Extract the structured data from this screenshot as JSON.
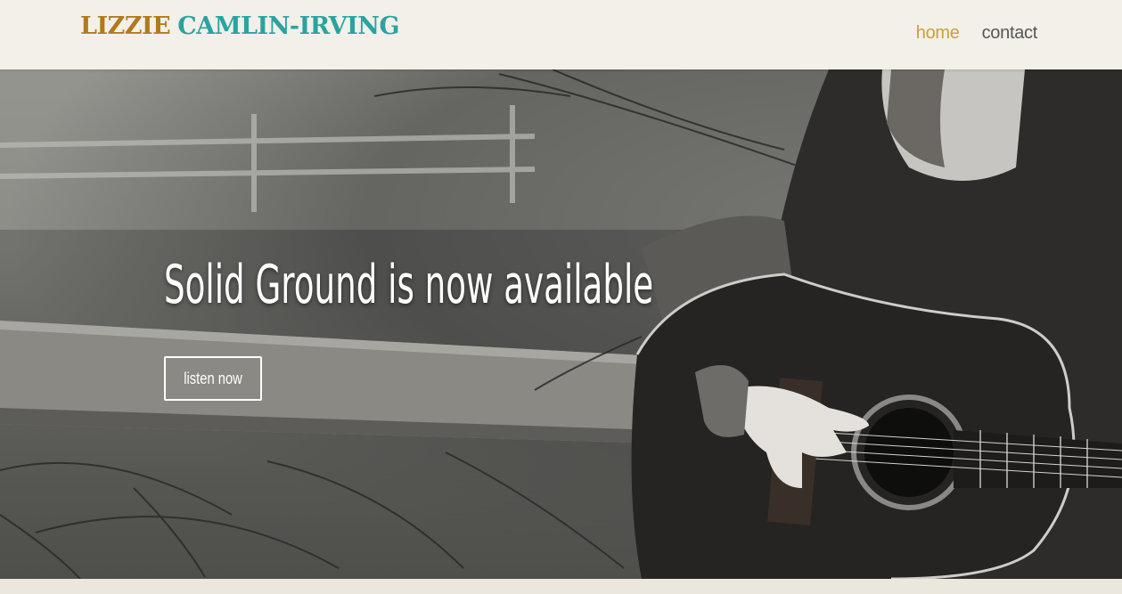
{
  "header": {
    "logo_first": "LIZZIE",
    "logo_last": "CAMLIN-IRVING",
    "nav": [
      {
        "label": "home",
        "active": true
      },
      {
        "label": "contact",
        "active": false
      }
    ]
  },
  "hero": {
    "title": "Solid Ground is now available",
    "button_label": "listen now"
  },
  "colors": {
    "logo_first": "#b07a1c",
    "logo_last": "#2aa3a0",
    "nav_active": "#c9a13c",
    "nav_default": "#555555",
    "header_bg": "#f3f0e9"
  }
}
